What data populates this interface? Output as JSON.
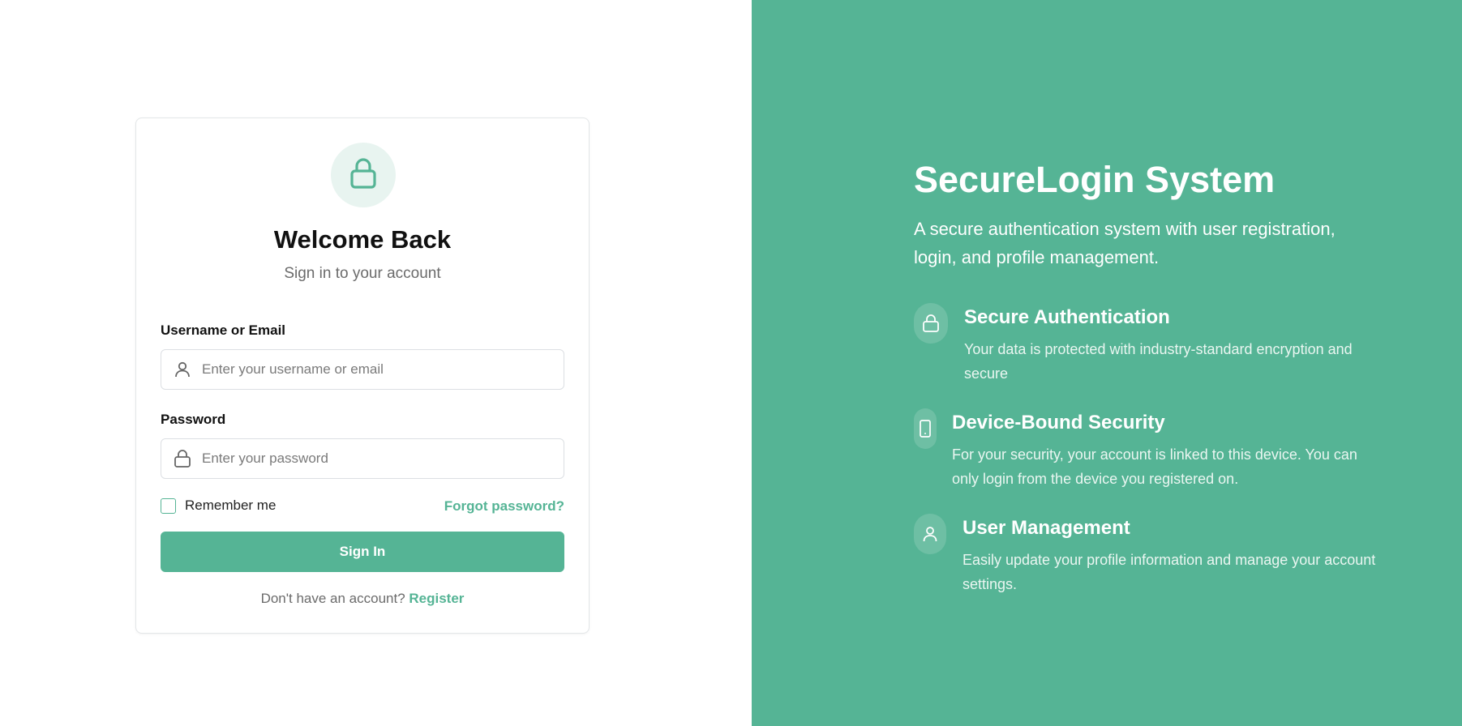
{
  "login": {
    "title": "Welcome Back",
    "subtitle": "Sign in to your account",
    "username_label": "Username or Email",
    "username_placeholder": "Enter your username or email",
    "password_label": "Password",
    "password_placeholder": "Enter your password",
    "remember_label": "Remember me",
    "forgot_label": "Forgot password?",
    "signin_label": "Sign In",
    "register_prompt": "Don't have an account?",
    "register_label": "Register"
  },
  "hero": {
    "title": "SecureLogin System",
    "description": "A secure authentication system with user registration, login, and profile management.",
    "features": [
      {
        "icon": "lock-icon",
        "title": "Secure Authentication",
        "description": "Your data is protected with industry-standard encryption and secure"
      },
      {
        "icon": "mobile-device-icon",
        "title": "Device-Bound Security",
        "description": "For your security, your account is linked to this device. You can only login from the device you registered on."
      },
      {
        "icon": "user-icon",
        "title": "User Management",
        "description": "Easily update your profile information and manage your account settings."
      }
    ]
  },
  "colors": {
    "accent": "#55b495",
    "accent_light": "#e8f4f0"
  }
}
